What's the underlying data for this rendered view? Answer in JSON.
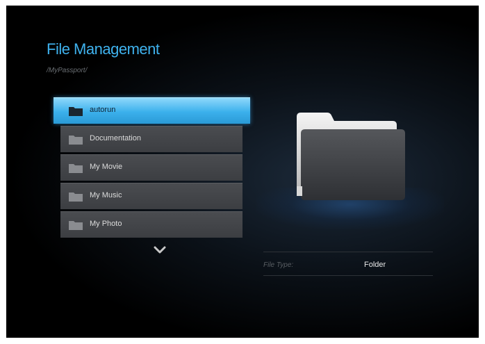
{
  "header": {
    "title": "File Management",
    "path": "/MyPassport/"
  },
  "file_list": {
    "items": [
      {
        "label": "autorun",
        "icon": "folder-icon",
        "selected": true
      },
      {
        "label": "Documentation",
        "icon": "folder-icon",
        "selected": false
      },
      {
        "label": "My Movie",
        "icon": "folder-icon",
        "selected": false
      },
      {
        "label": "My Music",
        "icon": "folder-icon",
        "selected": false
      },
      {
        "label": "My Photo",
        "icon": "folder-icon",
        "selected": false
      }
    ],
    "scroll_icon": "chevron-down-icon"
  },
  "preview": {
    "icon": "folder-icon",
    "file_type_label": "File Type:",
    "file_type_value": "Folder"
  },
  "colors": {
    "accent": "#3fb2ee",
    "selected_row": "#3bb0ec",
    "row": "#424448",
    "background": "#000000"
  }
}
